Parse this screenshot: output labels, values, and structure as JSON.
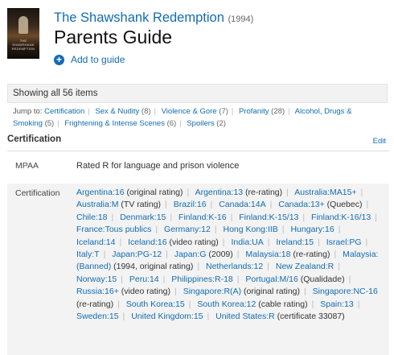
{
  "movie": {
    "title": "The Shawshank Redemption",
    "year": "(1994)",
    "poster_text": "THE SHAWSHANK REDEMPTION"
  },
  "page": {
    "title": "Parents Guide",
    "add_guide": "Add to guide"
  },
  "items_count": "Showing all 56 items",
  "jump": {
    "label": "Jump to:",
    "links": [
      {
        "label": "Certification",
        "count": ""
      },
      {
        "label": "Sex & Nudity",
        "count": "(8)"
      },
      {
        "label": "Violence & Gore",
        "count": "(7)"
      },
      {
        "label": "Profanity",
        "count": "(28)"
      },
      {
        "label": "Alcohol, Drugs & Smoking",
        "count": "(5)"
      },
      {
        "label": "Frightening & Intense Scenes",
        "count": "(6)"
      },
      {
        "label": "Spoilers",
        "count": "(2)"
      }
    ]
  },
  "certification": {
    "heading": "Certification",
    "edit": "Edit",
    "mpaa_label": "MPAA",
    "mpaa_value": "Rated R for language and prison violence",
    "cert_label": "Certification",
    "entries": [
      {
        "link": "Argentina:16",
        "note": "(original rating)"
      },
      {
        "link": "Argentina:13",
        "note": "(re-rating)"
      },
      {
        "link": "Australia:MA15+",
        "note": ""
      },
      {
        "link": "Australia:M",
        "note": "(TV rating)"
      },
      {
        "link": "Brazil:16",
        "note": ""
      },
      {
        "link": "Canada:14A",
        "note": ""
      },
      {
        "link": "Canada:13+",
        "note": "(Quebec)"
      },
      {
        "link": "Chile:18",
        "note": ""
      },
      {
        "link": "Denmark:15",
        "note": ""
      },
      {
        "link": "Finland:K-16",
        "note": ""
      },
      {
        "link": "Finland:K-15/13",
        "note": ""
      },
      {
        "link": "Finland:K-16/13",
        "note": ""
      },
      {
        "link": "France:Tous publics",
        "note": ""
      },
      {
        "link": "Germany:12",
        "note": ""
      },
      {
        "link": "Hong Kong:IIB",
        "note": ""
      },
      {
        "link": "Hungary:16",
        "note": ""
      },
      {
        "link": "Iceland:14",
        "note": ""
      },
      {
        "link": "Iceland:16",
        "note": "(video rating)"
      },
      {
        "link": "India:UA",
        "note": ""
      },
      {
        "link": "Ireland:15",
        "note": ""
      },
      {
        "link": "Israel:PG",
        "note": ""
      },
      {
        "link": "Italy:T",
        "note": ""
      },
      {
        "link": "Japan:PG-12",
        "note": ""
      },
      {
        "link": "Japan:G",
        "note": "(2009)"
      },
      {
        "link": "Malaysia:18",
        "note": "(re-rating)"
      },
      {
        "link": "Malaysia:(Banned)",
        "note": "(1994, original rating)"
      },
      {
        "link": "Netherlands:12",
        "note": ""
      },
      {
        "link": "New Zealand:R",
        "note": ""
      },
      {
        "link": "Norway:15",
        "note": ""
      },
      {
        "link": "Peru:14",
        "note": ""
      },
      {
        "link": "Philippines:R-18",
        "note": ""
      },
      {
        "link": "Portugal:M/16",
        "note": "(Qualidade)"
      },
      {
        "link": "Russia:16+",
        "note": "(video rating)"
      },
      {
        "link": "Singapore:R(A)",
        "note": "(original rating)"
      },
      {
        "link": "Singapore:NC-16",
        "note": "(re-rating)"
      },
      {
        "link": "South Korea:15",
        "note": ""
      },
      {
        "link": "South Korea:12",
        "note": "(cable rating)"
      },
      {
        "link": "Spain:13",
        "note": ""
      },
      {
        "link": "Sweden:15",
        "note": ""
      },
      {
        "link": "United Kingdom:15",
        "note": ""
      },
      {
        "link": "United States:R",
        "note": "(certificate 33087)"
      }
    ]
  },
  "colors": {
    "link": "#136cb2",
    "row_bg": "#f3f3f3",
    "accent": "#136cb2"
  }
}
